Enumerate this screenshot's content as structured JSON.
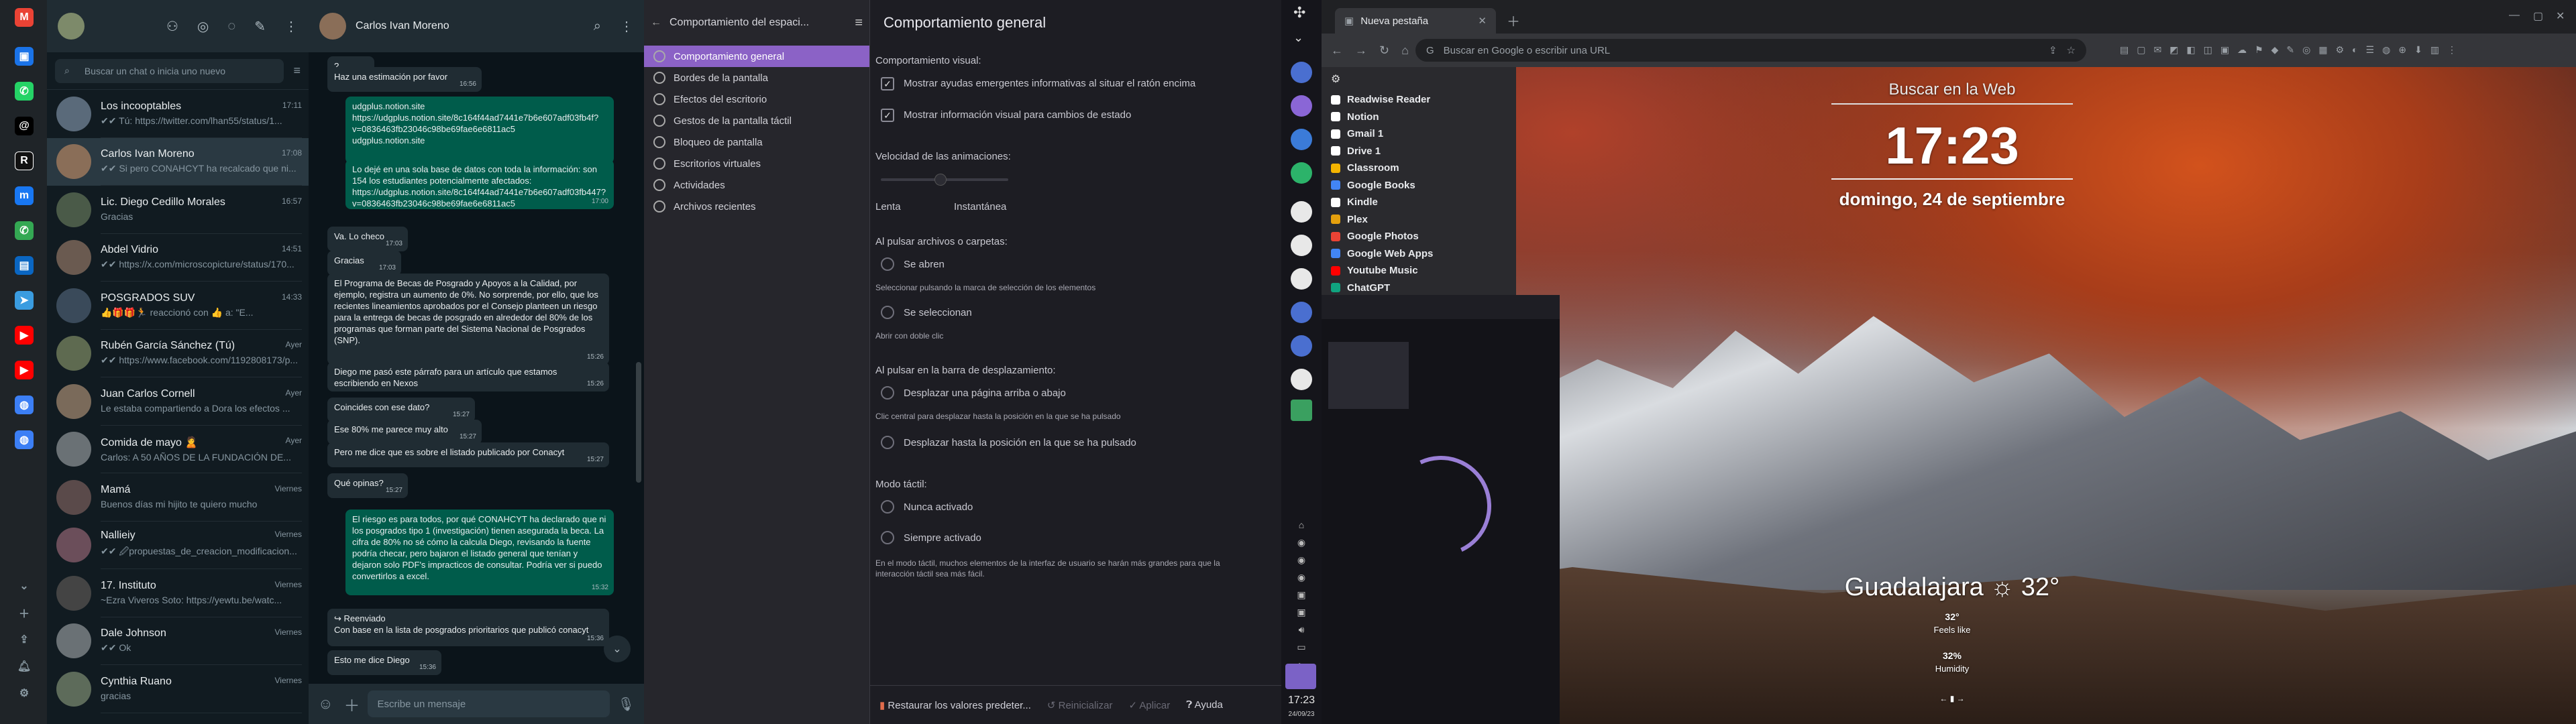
{
  "whatsapp": {
    "search_placeholder": "Buscar un chat o inicia uno nuevo",
    "chats": [
      {
        "name": "Los incooptables",
        "time": "17:11",
        "preview": "✔✔ Tú: https://twitter.com/lhan55/status/1..."
      },
      {
        "name": "Carlos Ivan Moreno",
        "time": "17:08",
        "preview": "✔✔ Si pero CONAHCYT ha recalcado que ni..."
      },
      {
        "name": "Lic. Diego Cedillo Morales",
        "time": "16:57",
        "preview": "Gracias"
      },
      {
        "name": "Abdel Vidrio",
        "time": "14:51",
        "preview": "✔✔ https://x.com/microscopicture/status/170..."
      },
      {
        "name": "POSGRADOS SUV",
        "time": "14:33",
        "preview": "👍🎁🎁🏃 reaccionó con 👍 a: \"E..."
      },
      {
        "name": "Rubén García Sánchez (Tú)",
        "time": "Ayer",
        "preview": "✔✔ https://www.facebook.com/1192808173/p..."
      },
      {
        "name": "Juan Carlos Cornell",
        "time": "Ayer",
        "preview": "Le estaba compartiendo a Dora los efectos ..."
      },
      {
        "name": "Comida de mayo 🙎",
        "time": "Ayer",
        "preview": "Carlos: A 50 AÑOS DE LA FUNDACIÓN DE..."
      },
      {
        "name": "Mamá",
        "time": "Viernes",
        "preview": "Buenos días mi hijito te quiero mucho"
      },
      {
        "name": "Nallieiy",
        "time": "Viernes",
        "preview": "✔✔ 🖉propuestas_de_creacion_modificacion..."
      },
      {
        "name": "17. Instituto",
        "time": "Viernes",
        "preview": "~Ezra Viveros Soto: https://yewtu.be/watc..."
      },
      {
        "name": "Dale Johnson",
        "time": "Viernes",
        "preview": "✔✔ Ok"
      },
      {
        "name": "Cynthia Ruano",
        "time": "Viernes",
        "preview": "gracias"
      }
    ]
  },
  "conversation": {
    "contact": "Carlos Ivan Moreno",
    "input_placeholder": "Escribe un mensaje",
    "messages": [
      {
        "dir": "in",
        "text": "? ",
        "time": "16:47"
      },
      {
        "dir": "in",
        "text": "Haz una estimación por favor",
        "time": "16:56"
      },
      {
        "dir": "out",
        "text": "udgplus.notion.site\nhttps://udgplus.notion.site/8c164f44ad7441e7b6e607adf03fb4f?v=0836463fb23046c98be69fae6e6811ac5\nudgplus.notion.site",
        "time": ""
      },
      {
        "dir": "out",
        "text": "Lo dejé en una sola base de datos con toda la información: son 154 los estudiantes potencialmente afectados: https://udgplus.notion.site/8c164f44ad7441e7b6e607adf03fb447?v=0836463fb23046c98be69fae6e6811ac5",
        "time": "17:00"
      },
      {
        "dir": "in",
        "text": "Va. Lo checo",
        "time": "17:03"
      },
      {
        "dir": "in",
        "text": "Gracias",
        "time": "17:03"
      },
      {
        "dir": "in",
        "text": "El Programa de Becas de Posgrado y Apoyos a la Calidad, por ejemplo, registra un aumento de 0%. No sorprende, por ello, que los recientes lineamientos aprobados por el Consejo planteen un riesgo para la entrega de becas de posgrado en alrededor del 80% de los programas que forman parte del Sistema Nacional de Posgrados (SNP).",
        "time": "15:26"
      },
      {
        "dir": "in",
        "text": "Diego me pasó este párrafo para un artículo que estamos escribiendo en Nexos",
        "time": "15:26"
      },
      {
        "dir": "in",
        "text": "Coincides con ese dato?",
        "time": "15:27"
      },
      {
        "dir": "in",
        "text": "Ese 80% me parece muy alto",
        "time": "15:27"
      },
      {
        "dir": "in",
        "text": "Pero me dice que es sobre el listado publicado por Conacyt",
        "time": "15:27"
      },
      {
        "dir": "in",
        "text": "Qué opinas?",
        "time": "15:27"
      },
      {
        "dir": "out",
        "text": "El riesgo es para todos, por qué CONAHCYT ha declarado que ni los posgrados tipo 1 (investigación) tienen asegurada la beca. La cifra de 80% no sé cómo la calcula Diego, revisando la fuente podría checar, pero bajaron el listado general que tenían y dejaron solo PDF's impracticos de consultar. Podría ver si puedo convertirlos a excel.",
        "time": "15:32"
      },
      {
        "dir": "in",
        "text": "↪ Reenviado\nCon base en la lista de posgrados prioritarios que publicó conacyt",
        "time": "15:36"
      },
      {
        "dir": "in",
        "text": "Esto me dice Diego",
        "time": "15:36"
      }
    ]
  },
  "settings": {
    "window_title": "Comportamiento del espaci...",
    "sidebar": [
      {
        "label": "Comportamiento general",
        "active": true
      },
      {
        "label": "Bordes de la pantalla"
      },
      {
        "label": "Efectos del escritorio"
      },
      {
        "label": "Gestos de la pantalla táctil"
      },
      {
        "label": "Bloqueo de pantalla"
      },
      {
        "label": "Escritorios virtuales"
      },
      {
        "label": "Actividades"
      },
      {
        "label": "Archivos recientes"
      }
    ],
    "title": "Comportamiento general",
    "visual_label": "Comportamiento visual:",
    "chk1": "Mostrar ayudas emergentes informativas al situar el ratón encima",
    "chk2": "Mostrar información visual para cambios de estado",
    "anim_label": "Velocidad de las animaciones:",
    "anim_slow": "Lenta",
    "anim_fast": "Instantánea",
    "click_label": "Al pulsar archivos o carpetas:",
    "opt_open": "Se abren",
    "opt_open_hint": "Seleccionar pulsando la marca de selección de los elementos",
    "opt_select": "Se seleccionan",
    "opt_select_hint": "Abrir con doble clic",
    "scroll_label": "Al pulsar en la barra de desplazamiento:",
    "opt_page": "Desplazar una página arriba o abajo",
    "opt_page_hint": "Clic central para desplazar hasta la posición en la que se ha pulsado",
    "opt_pos": "Desplazar hasta la posición en la que se ha pulsado",
    "touch_label": "Modo táctil:",
    "opt_never": "Nunca activado",
    "opt_always": "Siempre activado",
    "touch_hint": "En el modo táctil, muchos elementos de la interfaz de usuario se harán más grandes para que la interacción táctil sea más fácil.",
    "btn_reset": "Restaurar los valores predeter...",
    "btn_reinit": "Reinicializar",
    "btn_apply": "Aplicar",
    "btn_help": "Ayuda"
  },
  "dock": {
    "time": "17:23",
    "date": "24/09/23"
  },
  "browser": {
    "tab_title": "Nueva pestaña",
    "omnibox": "Buscar en Google o escribir una URL",
    "bookmarks": [
      {
        "label": "Readwise Reader",
        "color": "#ffffff"
      },
      {
        "label": "Notion",
        "color": "#ffffff"
      },
      {
        "label": "Gmail 1",
        "color": "#ffffff"
      },
      {
        "label": "Drive 1",
        "color": "#ffffff"
      },
      {
        "label": "Classroom",
        "color": "#f4b400"
      },
      {
        "label": "Google Books",
        "color": "#4285f4"
      },
      {
        "label": "Kindle",
        "color": "#ffffff"
      },
      {
        "label": "Plex",
        "color": "#e5a00d"
      },
      {
        "label": "Google Photos",
        "color": "#ea4335"
      },
      {
        "label": "Google Web Apps",
        "color": "#4285f4"
      },
      {
        "label": "Youtube Music",
        "color": "#ff0000"
      },
      {
        "label": "ChatGPT",
        "color": "#10a37f"
      }
    ],
    "search_label": "Buscar en la Web",
    "clock": "17:23",
    "date": "domingo, 24 de septiembre",
    "weather_city": "Guadalajara",
    "weather_temp": "32°",
    "feels_value": "32°",
    "feels_label": "Feels like",
    "humidity_value": "32%",
    "humidity_label": "Humidity"
  }
}
